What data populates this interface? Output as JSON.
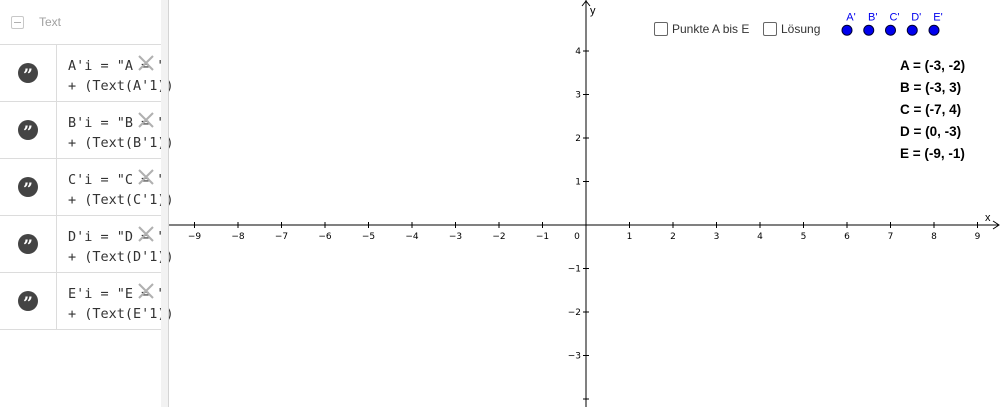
{
  "algebra": {
    "group_label": "Text",
    "rows": [
      {
        "line1": "A'i = \"A = \"",
        "line2": "+ (Text(A'1))"
      },
      {
        "line1": "B'i = \"B = \"",
        "line2": "+ (Text(B'1))"
      },
      {
        "line1": "C'i = \"C = \"",
        "line2": "+ (Text(C'1))"
      },
      {
        "line1": "D'i = \"D = \"",
        "line2": "+ (Text(D'1))"
      },
      {
        "line1": "E'i = \"E = \"",
        "line2": "+ (Text(E'1))"
      }
    ]
  },
  "graphics": {
    "x_axis_label": "x",
    "y_axis_label": "y",
    "x_ticks": [
      "−9",
      "−8",
      "−7",
      "−6",
      "−5",
      "−4",
      "−3",
      "−2",
      "−1",
      "0",
      "1",
      "2",
      "3",
      "4",
      "5",
      "6",
      "7",
      "8",
      "9"
    ],
    "y_ticks": [
      "4",
      "3",
      "2",
      "1",
      "−1",
      "−2",
      "−3"
    ],
    "checkboxes": [
      {
        "label": "Punkte A bis E",
        "checked": false
      },
      {
        "label": "Lösung",
        "checked": false
      }
    ],
    "point_color": "#0000ee",
    "points": [
      {
        "label": "A'",
        "x": 6,
        "y": 4.5
      },
      {
        "label": "B'",
        "x": 6.5,
        "y": 4.5
      },
      {
        "label": "C'",
        "x": 7,
        "y": 4.5
      },
      {
        "label": "D'",
        "x": 7.5,
        "y": 4.5
      },
      {
        "label": "E'",
        "x": 8,
        "y": 4.5
      }
    ],
    "coordinates": [
      "A = (-3, -2)",
      "B = (-3, 3)",
      "C = (-7, 4)",
      "D = (0, -3)",
      "E = (-9, -1)"
    ]
  }
}
